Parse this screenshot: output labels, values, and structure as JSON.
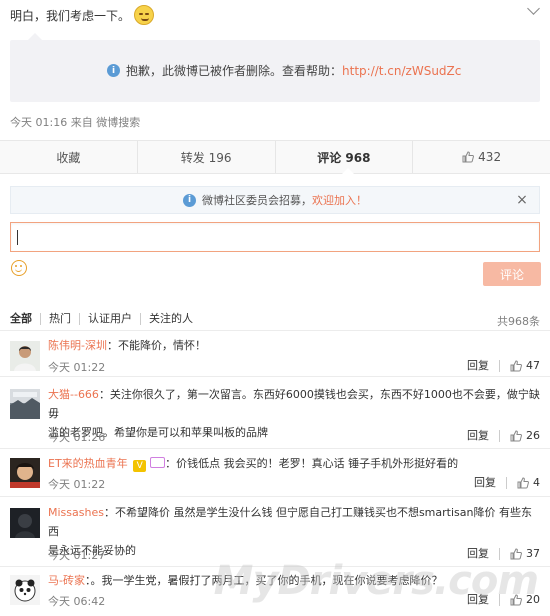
{
  "post": {
    "text": "明白，我们考虑一下。",
    "deleted_notice": "抱歉，此微博已被作者删除。查看帮助：",
    "help_link": "http://t.cn/zWSudZc",
    "meta": "今天 01:16 来自 微博搜索"
  },
  "actions": {
    "favorite": "收藏",
    "repost": "转发 196",
    "comment": "评论 968",
    "like": "432"
  },
  "recruit": {
    "text": "微博社区委员会招募，",
    "link": "欢迎加入！"
  },
  "composer": {
    "submit": "评论"
  },
  "filters": {
    "all": "全部",
    "hot": "热门",
    "verified": "认证用户",
    "following": "关注的人",
    "total": "共968条"
  },
  "labels": {
    "reply": "回复"
  },
  "comments": [
    {
      "name": "陈伟明-深圳",
      "text": "：不能降价，情怀！",
      "text2": "",
      "time": "今天 01:22",
      "likes": "47"
    },
    {
      "name": "大猫--666",
      "text": "：关注你很久了，第一次留言。东西好6000摸钱也会买，东西不好1000也不会要，做宁缺毋",
      "text2": "滥的老罗吧。希望你是可以和苹果叫板的品牌",
      "time": "今天 01:26",
      "likes": "26"
    },
    {
      "name": "ET来的热血青年",
      "vip": "V",
      "text": "：价钱低点 我会买的！老罗！真心话 锤子手机外形挺好看的",
      "text2": "",
      "time": "今天 01:22",
      "likes": "4"
    },
    {
      "name": "Missashes",
      "text": "：不希望降价 虽然是学生没什么钱 但宁愿自己打工赚钱买也不想smartisan降价 有些东西",
      "text2": "是永远不能妥协的",
      "time": "今天 01:27",
      "likes": "37"
    },
    {
      "name": "马-砖家",
      "text": "：。我一学生党，暑假打了两月工，买了你的手机，现在你说要考虑降价？",
      "text2": "",
      "time": "今天 06:42",
      "likes": "20"
    }
  ],
  "watermark": "MyDrivers.com",
  "colors": {
    "accent": "#eb7350",
    "submit_disabled": "#f7b9a3",
    "info_blue": "#5b9bd5"
  }
}
